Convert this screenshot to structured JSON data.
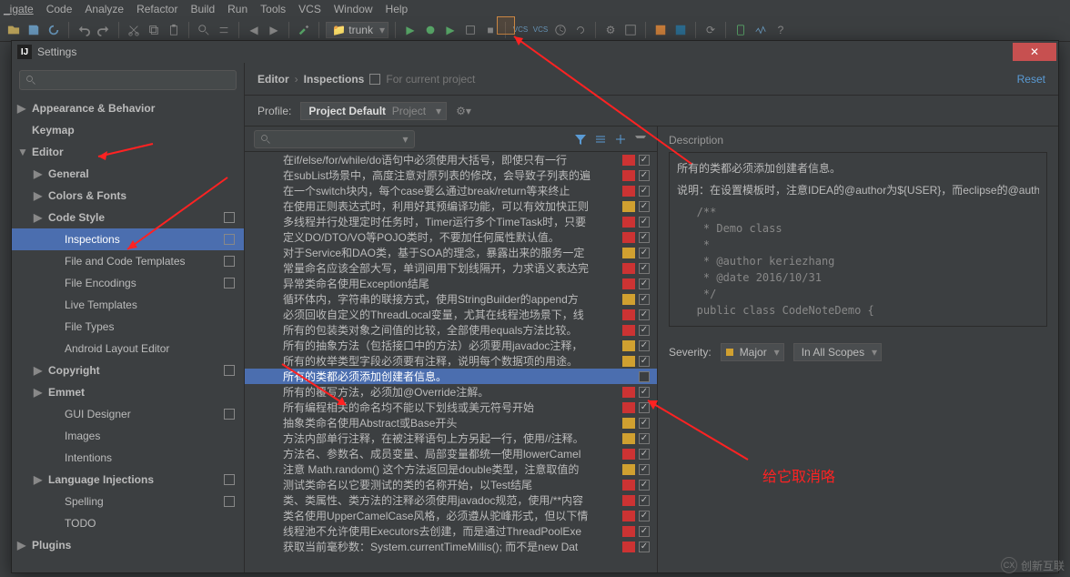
{
  "menubar": [
    "_igate",
    "Code",
    "Analyze",
    "Refactor",
    "Build",
    "Run",
    "Tools",
    "VCS",
    "Window",
    "Help"
  ],
  "branch": "trunk",
  "dialog": {
    "title": "Settings",
    "reset": "Reset",
    "breadcrumb": {
      "a": "Editor",
      "b": "Inspections",
      "hint": "For current project"
    },
    "profile_label": "Profile:",
    "profile_value": "Project Default",
    "profile_scope": "Project"
  },
  "nav": [
    {
      "lvl": "top",
      "arrow": "▶",
      "label": "Appearance & Behavior"
    },
    {
      "lvl": "top",
      "label": "Keymap"
    },
    {
      "lvl": "top",
      "arrow": "▼",
      "label": "Editor"
    },
    {
      "lvl": "sub1",
      "arrow": "▶",
      "label": "General"
    },
    {
      "lvl": "sub1",
      "arrow": "▶",
      "label": "Colors & Fonts"
    },
    {
      "lvl": "sub1",
      "arrow": "▶",
      "label": "Code Style",
      "proj": true
    },
    {
      "lvl": "leaf",
      "label": "Inspections",
      "proj": true,
      "sel": true
    },
    {
      "lvl": "leaf",
      "label": "File and Code Templates",
      "proj": true
    },
    {
      "lvl": "leaf",
      "label": "File Encodings",
      "proj": true
    },
    {
      "lvl": "leaf",
      "label": "Live Templates"
    },
    {
      "lvl": "leaf",
      "label": "File Types"
    },
    {
      "lvl": "leaf",
      "label": "Android Layout Editor"
    },
    {
      "lvl": "sub1",
      "arrow": "▶",
      "label": "Copyright",
      "proj": true
    },
    {
      "lvl": "sub1",
      "arrow": "▶",
      "label": "Emmet"
    },
    {
      "lvl": "leaf",
      "label": "GUI Designer",
      "proj": true
    },
    {
      "lvl": "leaf",
      "label": "Images"
    },
    {
      "lvl": "leaf",
      "label": "Intentions"
    },
    {
      "lvl": "sub1",
      "arrow": "▶",
      "label": "Language Injections",
      "proj": true
    },
    {
      "lvl": "leaf",
      "label": "Spelling",
      "proj": true
    },
    {
      "lvl": "leaf",
      "label": "TODO"
    },
    {
      "lvl": "top",
      "arrow": "▶",
      "label": "Plugins"
    }
  ],
  "inspections": [
    {
      "txt": "在if/else/for/while/do语句中必须使用大括号，即使只有一行",
      "sev": "error",
      "on": true
    },
    {
      "txt": "在subList场景中，高度注意对原列表的修改，会导致子列表的遍",
      "sev": "error",
      "on": true
    },
    {
      "txt": "在一个switch块内，每个case要么通过break/return等来终止",
      "sev": "error",
      "on": true
    },
    {
      "txt": "在使用正则表达式时，利用好其预编译功能，可以有效加快正则",
      "sev": "warn",
      "on": true
    },
    {
      "txt": "多线程并行处理定时任务时，Timer运行多个TimeTask时，只要",
      "sev": "error",
      "on": true
    },
    {
      "txt": "定义DO/DTO/VO等POJO类时，不要加任何属性默认值。",
      "sev": "error",
      "on": true
    },
    {
      "txt": "对于Service和DAO类，基于SOA的理念，暴露出来的服务一定",
      "sev": "warn",
      "on": true
    },
    {
      "txt": "常量命名应该全部大写，单词间用下划线隔开，力求语义表达完",
      "sev": "error",
      "on": true
    },
    {
      "txt": "异常类命名使用Exception结尾",
      "sev": "error",
      "on": true
    },
    {
      "txt": "循环体内，字符串的联接方式，使用StringBuilder的append方",
      "sev": "warn",
      "on": true
    },
    {
      "txt": "必须回收自定义的ThreadLocal变量，尤其在线程池场景下，线",
      "sev": "error",
      "on": true
    },
    {
      "txt": "所有的包装类对象之间值的比较，全部使用equals方法比较。",
      "sev": "error",
      "on": true
    },
    {
      "txt": "所有的抽象方法（包括接口中的方法）必须要用javadoc注释，",
      "sev": "warn",
      "on": true
    },
    {
      "txt": "所有的枚举类型字段必须要有注释，说明每个数据项的用途。",
      "sev": "warn",
      "on": true
    },
    {
      "txt": "所有的类都必须添加创建者信息。",
      "sev": "",
      "on": false,
      "sel": true
    },
    {
      "txt": "所有的覆写方法，必须加@Override注解。",
      "sev": "error",
      "on": true
    },
    {
      "txt": "所有编程相关的命名均不能以下划线或美元符号开始",
      "sev": "error",
      "on": true
    },
    {
      "txt": "抽象类命名使用Abstract或Base开头",
      "sev": "warn",
      "on": true
    },
    {
      "txt": "方法内部单行注释，在被注释语句上方另起一行，使用//注释。",
      "sev": "warn",
      "on": true
    },
    {
      "txt": "方法名、参数名、成员变量、局部变量都统一使用lowerCamel",
      "sev": "error",
      "on": true
    },
    {
      "txt": "注意 Math.random() 这个方法返回是double类型，注意取值的",
      "sev": "warn",
      "on": true
    },
    {
      "txt": "测试类命名以它要测试的类的名称开始，以Test结尾",
      "sev": "error",
      "on": true
    },
    {
      "txt": "类、类属性、类方法的注释必须使用javadoc规范，使用/**内容",
      "sev": "error",
      "on": true
    },
    {
      "txt": "类名使用UpperCamelCase风格，必须遵从驼峰形式，但以下情",
      "sev": "error",
      "on": true
    },
    {
      "txt": "线程池不允许使用Executors去创建，而是通过ThreadPoolExe",
      "sev": "error",
      "on": true
    },
    {
      "txt": "获取当前毫秒数：System.currentTimeMillis(); 而不是new Dat",
      "sev": "error",
      "on": true
    }
  ],
  "desc": {
    "heading": "Description",
    "line1": "所有的类都必须添加创建者信息。",
    "line2_a": "说明：在设置模板时，注意IDEA的@author为${USER}，而eclipse的@author为${",
    "code": "   /**\n    * Demo class\n    *\n    * @author keriezhang\n    * @date 2016/10/31\n    */\n   public class CodeNoteDemo {\n",
    "sev_label": "Severity:",
    "sev_value": "Major",
    "scope_value": "In All Scopes"
  },
  "annotation_text": "给它取消咯",
  "watermark": "创新互联"
}
